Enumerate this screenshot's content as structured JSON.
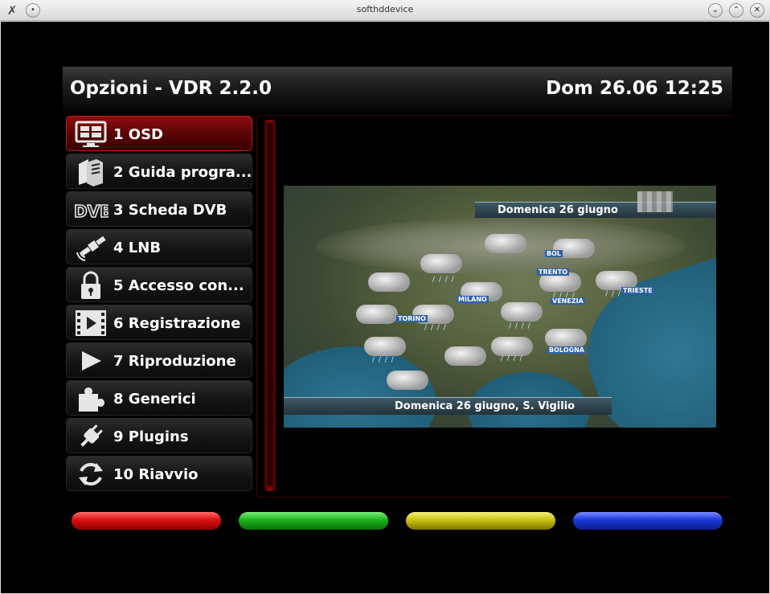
{
  "window": {
    "title": "softhddevice",
    "app_icon": "x-icon",
    "controls": [
      "minimize",
      "maximize",
      "close"
    ]
  },
  "header": {
    "title": "Opzioni - VDR 2.2.0",
    "datetime": "Dom 26.06 12:25"
  },
  "menu": {
    "items": [
      {
        "label": "1 OSD",
        "icon": "osd-icon",
        "selected": true
      },
      {
        "label": "2 Guida progra...",
        "icon": "epg-book-icon",
        "selected": false
      },
      {
        "label": "3 Scheda DVB",
        "icon": "dvb-icon",
        "selected": false
      },
      {
        "label": "4 LNB",
        "icon": "satellite-icon",
        "selected": false
      },
      {
        "label": "5 Accesso con...",
        "icon": "lock-icon",
        "selected": false
      },
      {
        "label": "6 Registrazione",
        "icon": "film-icon",
        "selected": false
      },
      {
        "label": "7 Riproduzione",
        "icon": "play-icon",
        "selected": false
      },
      {
        "label": "8 Generici",
        "icon": "puzzle-icon",
        "selected": false
      },
      {
        "label": "9 Plugins",
        "icon": "plug-icon",
        "selected": false
      },
      {
        "label": "10 Riavvio",
        "icon": "restart-icon",
        "selected": false
      }
    ]
  },
  "preview": {
    "top_caption": "Domenica 26 giugno",
    "bottom_caption": "Domenica 26 giugno, S. Vigilio",
    "cities": [
      "BOL",
      "TRENTO",
      "MILANO",
      "VENEZIA",
      "TRIESTE",
      "TORINO",
      "BOLOGNA"
    ]
  },
  "color_keys": {
    "red": "#d81010",
    "green": "#1cb31c",
    "yellow": "#c9c110",
    "blue": "#1838d8"
  }
}
